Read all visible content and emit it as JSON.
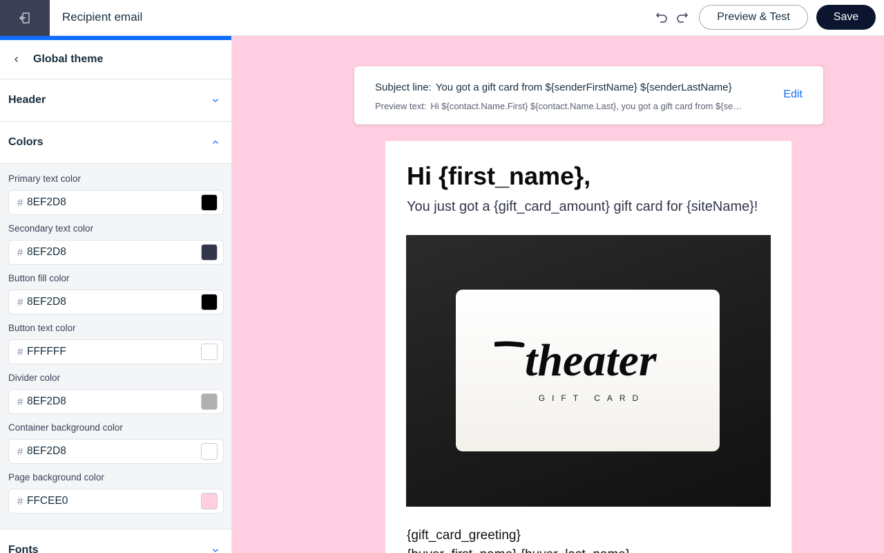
{
  "header": {
    "title": "Recipient email",
    "preview_label": "Preview & Test",
    "save_label": "Save"
  },
  "sidebar": {
    "panel_title": "Global theme",
    "sections": {
      "header": "Header",
      "colors": "Colors",
      "fonts": "Fonts"
    },
    "color_fields": [
      {
        "label": "Primary text color",
        "value": "8EF2D8",
        "swatch": "#000000"
      },
      {
        "label": "Secondary text color",
        "value": "8EF2D8",
        "swatch": "#32364A"
      },
      {
        "label": "Button fill color",
        "value": "8EF2D8",
        "swatch": "#000000"
      },
      {
        "label": "Button text color",
        "value": "FFFFFF",
        "swatch": "#FFFFFF"
      },
      {
        "label": "Divider color",
        "value": "8EF2D8",
        "swatch": "#B0B0B0"
      },
      {
        "label": "Container background color",
        "value": "8EF2D8",
        "swatch": "#FFFFFF"
      },
      {
        "label": "Page background color",
        "value": "FFCEE0",
        "swatch": "#FFCEE0"
      }
    ],
    "hash_symbol": "#"
  },
  "canvas": {
    "background": "#FFCEE0",
    "subject_label": "Subject line:",
    "subject_value": "You got a gift card from ${senderFirstName} ${senderLastName}",
    "preview_label": "Preview text:",
    "preview_value": "Hi ${contact.Name.First} ${contact.Name.Last}, you got a gift card from ${senderFirstName}",
    "edit_label": "Edit"
  },
  "email": {
    "greeting": "Hi {first_name},",
    "subgreeting": "You just got a {gift_card_amount} gift card for {siteName}!",
    "brand_name": "theater",
    "brand_sub": "GIFT CARD",
    "card_greeting": "{gift_card_greeting}",
    "buyer_line": "{buyer_first_name} {buyer_last_name}"
  },
  "colors": {
    "accent": "#116DFF",
    "save_button": "#0C1530",
    "exit_button": "#3B4057"
  },
  "icons": {
    "exit": "exit-icon",
    "undo": "undo-icon",
    "redo": "redo-icon",
    "back": "chevron-left-icon",
    "expand": "chevron-down-icon",
    "collapse": "chevron-up-icon"
  }
}
